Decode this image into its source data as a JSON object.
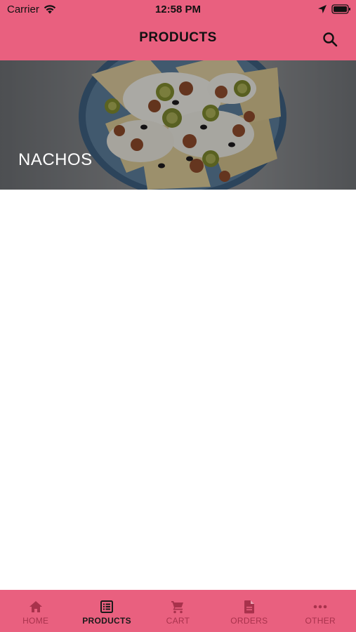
{
  "status_bar": {
    "carrier": "Carrier",
    "time": "12:58 PM"
  },
  "header": {
    "title": "PRODUCTS",
    "search_icon": "search-icon"
  },
  "categories": [
    {
      "label": "NACHOS"
    }
  ],
  "tabbar": {
    "items": [
      {
        "label": "HOME",
        "icon": "home-icon",
        "active": false
      },
      {
        "label": "PRODUCTS",
        "icon": "list-icon",
        "active": true
      },
      {
        "label": "CART",
        "icon": "cart-icon",
        "active": false
      },
      {
        "label": "ORDERS",
        "icon": "document-icon",
        "active": false
      },
      {
        "label": "OTHER",
        "icon": "more-icon",
        "active": false
      }
    ]
  },
  "colors": {
    "accent": "#e9607f",
    "inactive_tab": "#a8324c",
    "active_tab": "#1a1a1a"
  }
}
